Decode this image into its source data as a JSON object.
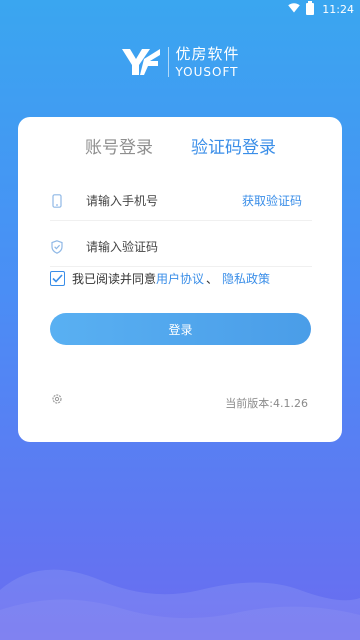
{
  "status": {
    "time": "11:24"
  },
  "brand": {
    "name_cn": "优房软件",
    "name_en": "YOUSOFT"
  },
  "tabs": [
    {
      "label": "账号登录",
      "active": false
    },
    {
      "label": "验证码登录",
      "active": true
    }
  ],
  "form": {
    "phone_placeholder": "请输入手机号",
    "code_placeholder": "请输入验证码",
    "get_code_label": "获取验证码"
  },
  "agreement": {
    "checked": true,
    "prefix": "我已阅读并同意",
    "user_agreement": "用户协议",
    "separator": "、",
    "privacy_policy": "隐私政策"
  },
  "login_button_label": "登录",
  "version_text": "当前版本:4.1.26",
  "colors": {
    "accent": "#3a8ee8",
    "button": "#52a6ee"
  }
}
